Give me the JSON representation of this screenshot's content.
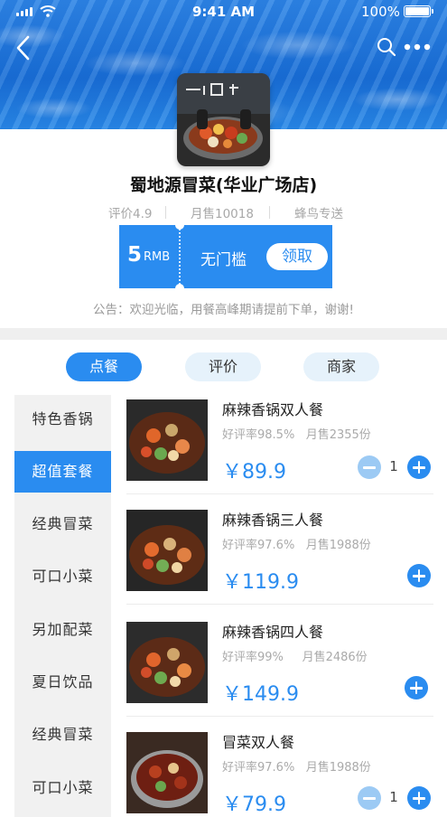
{
  "status_bar": {
    "time": "9:41 AM",
    "battery": "100%"
  },
  "shop": {
    "name": "蜀地源冒菜(华业广场店)",
    "rating": "评价4.9",
    "monthly_sales": "月售10018",
    "delivery": "蜂鸟专送",
    "logo_icon": "food-photo-icon"
  },
  "coupon": {
    "amount": "5",
    "unit": "RMB",
    "condition": "无门槛",
    "claim_label": "领取"
  },
  "notice": "公告：欢迎光临，用餐高峰期请提前下单，谢谢!",
  "tabs": [
    {
      "label": "点餐",
      "active": true
    },
    {
      "label": "评价",
      "active": false
    },
    {
      "label": "商家",
      "active": false
    }
  ],
  "categories": [
    {
      "label": "特色香锅",
      "active": false
    },
    {
      "label": "超值套餐",
      "active": true
    },
    {
      "label": "经典冒菜",
      "active": false
    },
    {
      "label": "可口小菜",
      "active": false
    },
    {
      "label": "另加配菜",
      "active": false
    },
    {
      "label": "夏日饮品",
      "active": false
    },
    {
      "label": "经典冒菜",
      "active": false
    },
    {
      "label": "可口小菜",
      "active": false
    }
  ],
  "dishes": [
    {
      "name": "麻辣香锅双人餐",
      "rating": "好评率98.5%",
      "sales": "月售2355份",
      "price": "￥89.9",
      "quantity": "1"
    },
    {
      "name": "麻辣香锅三人餐",
      "rating": "好评率97.6%",
      "sales": "月售1988份",
      "price": "￥119.9",
      "quantity": ""
    },
    {
      "name": "麻辣香锅四人餐",
      "rating": "好评率99%",
      "sales": "月售2486份",
      "price": "￥149.9",
      "quantity": ""
    },
    {
      "name": "冒菜双人餐",
      "rating": "好评率97.6%",
      "sales": "月售1988份",
      "price": "￥79.9",
      "quantity": "1"
    }
  ],
  "colors": {
    "accent": "#2a8cf0",
    "accent_light": "#e6f2fb",
    "muted_text": "#aaaaaa",
    "sidebar_bg": "#f1f1f1"
  }
}
